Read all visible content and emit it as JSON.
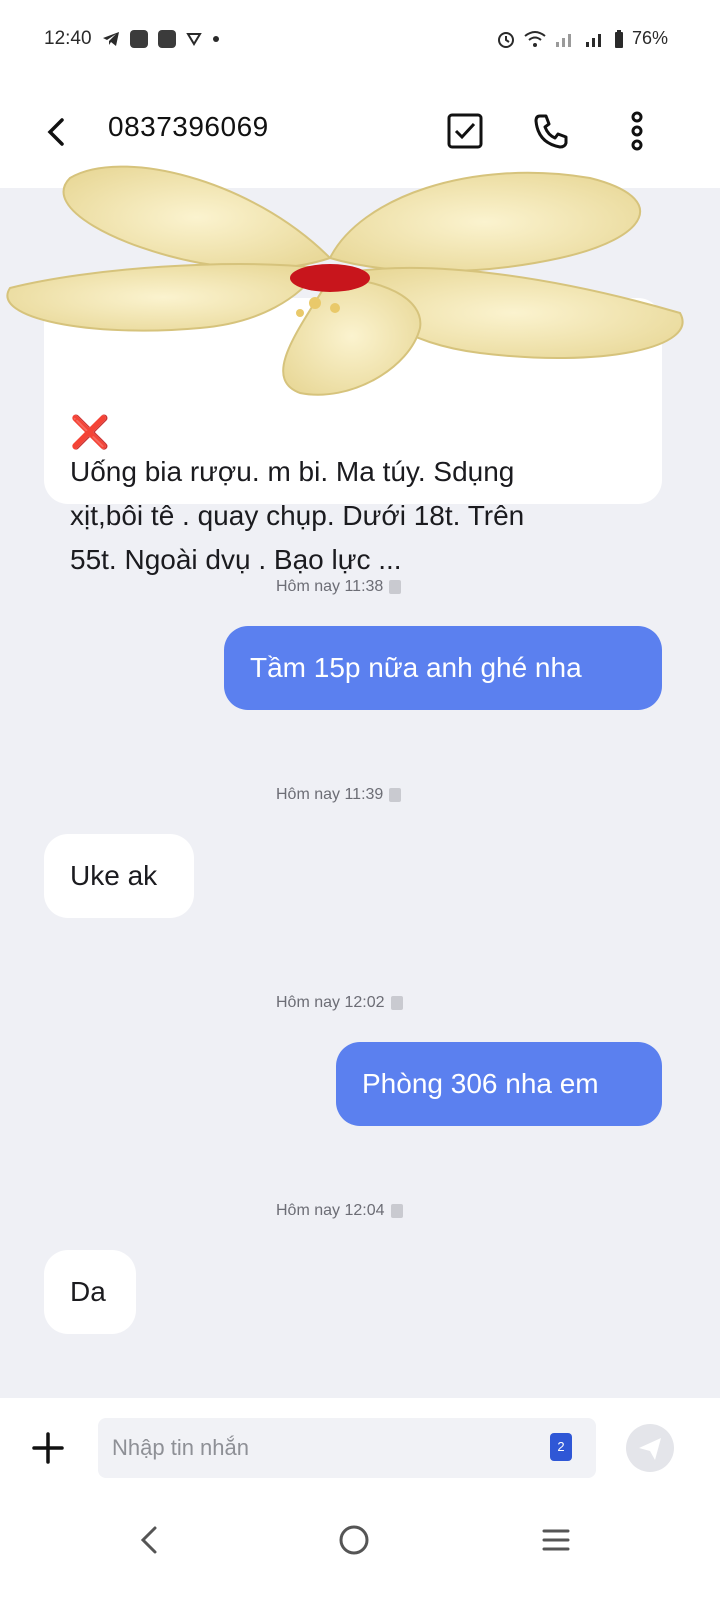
{
  "status_bar": {
    "time": "12:40",
    "battery": "76%",
    "icons": [
      "telegram-icon",
      "zalo-icon",
      "zalo-icon",
      "vpn-icon",
      "dot-icon",
      "alarm-icon",
      "wifi-icon",
      "signal-icon",
      "signal-icon",
      "battery-icon"
    ]
  },
  "header": {
    "back_icon": "back-arrow-icon",
    "contact": "0837396069",
    "select_icon": "checkbox-icon",
    "call_icon": "phone-icon",
    "more_icon": "more-vert-icon"
  },
  "messages": {
    "first_in": {
      "mark": "❌",
      "line1": "Uống bia rượu.",
      "line1b": "m bi. Ma túy. Sdụng",
      "line2": "xịt,bôi tê . quay chụp. Dưới 18t. Trên",
      "line3": "55t.  Ngoài dvụ . Bạo lực ..."
    },
    "ts1": "Hôm nay 11:38",
    "out1": "Tầm 15p nữa anh ghé nha",
    "ts2": "Hôm nay 11:39",
    "in2": "Uke ak",
    "ts3": "Hôm nay 12:02",
    "out2": "Phòng 306 nha em",
    "ts4": "Hôm nay 12:04",
    "in3": "Da"
  },
  "composer": {
    "placeholder": "Nhập tin nhắn",
    "sim_label": "2",
    "add_icon": "plus-icon",
    "send_icon": "send-icon"
  },
  "colors": {
    "outgoing": "#5b80ef",
    "incoming": "#ffffff",
    "background": "#eff0f5"
  }
}
